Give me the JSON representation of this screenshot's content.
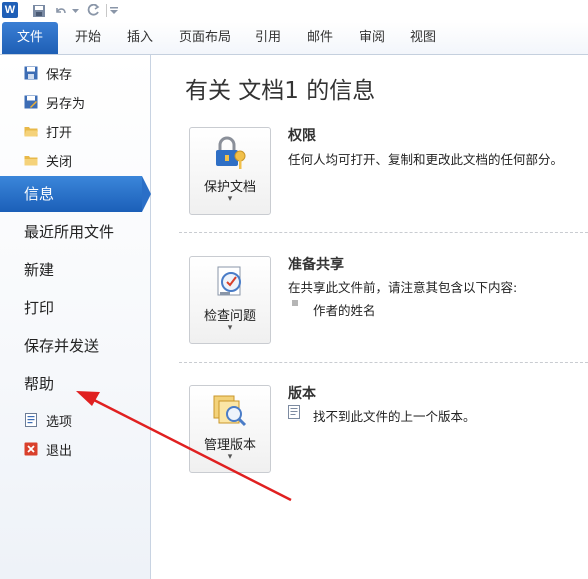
{
  "app": {
    "logo_letter": "W"
  },
  "ribbon": {
    "tabs": [
      {
        "label": "文件"
      },
      {
        "label": "开始"
      },
      {
        "label": "插入"
      },
      {
        "label": "页面布局"
      },
      {
        "label": "引用"
      },
      {
        "label": "邮件"
      },
      {
        "label": "审阅"
      },
      {
        "label": "视图"
      }
    ]
  },
  "backstage": {
    "small_items_top": [
      {
        "label": "保存",
        "icon": "save-icon"
      },
      {
        "label": "另存为",
        "icon": "save-as-icon"
      },
      {
        "label": "打开",
        "icon": "open-folder-icon"
      },
      {
        "label": "关闭",
        "icon": "close-folder-icon"
      }
    ],
    "big_items": [
      {
        "label": "信息"
      },
      {
        "label": "最近所用文件"
      },
      {
        "label": "新建"
      },
      {
        "label": "打印"
      },
      {
        "label": "保存并发送"
      },
      {
        "label": "帮助"
      }
    ],
    "small_items_bottom": [
      {
        "label": "选项",
        "icon": "options-icon"
      },
      {
        "label": "退出",
        "icon": "exit-icon"
      }
    ]
  },
  "info": {
    "title": "有关 文档1 的信息",
    "permissions": {
      "button": "保护文档",
      "heading": "权限",
      "desc": "任何人均可打开、复制和更改此文档的任何部分。"
    },
    "prepare": {
      "button": "检查问题",
      "heading": "准备共享",
      "desc": "在共享此文件前，请注意其包含以下内容:",
      "bullet": "作者的姓名"
    },
    "versions": {
      "button": "管理版本",
      "heading": "版本",
      "desc": "找不到此文件的上一个版本。"
    }
  },
  "colors": {
    "accent": "#1f5fb7",
    "annotation_arrow": "#e02020"
  }
}
